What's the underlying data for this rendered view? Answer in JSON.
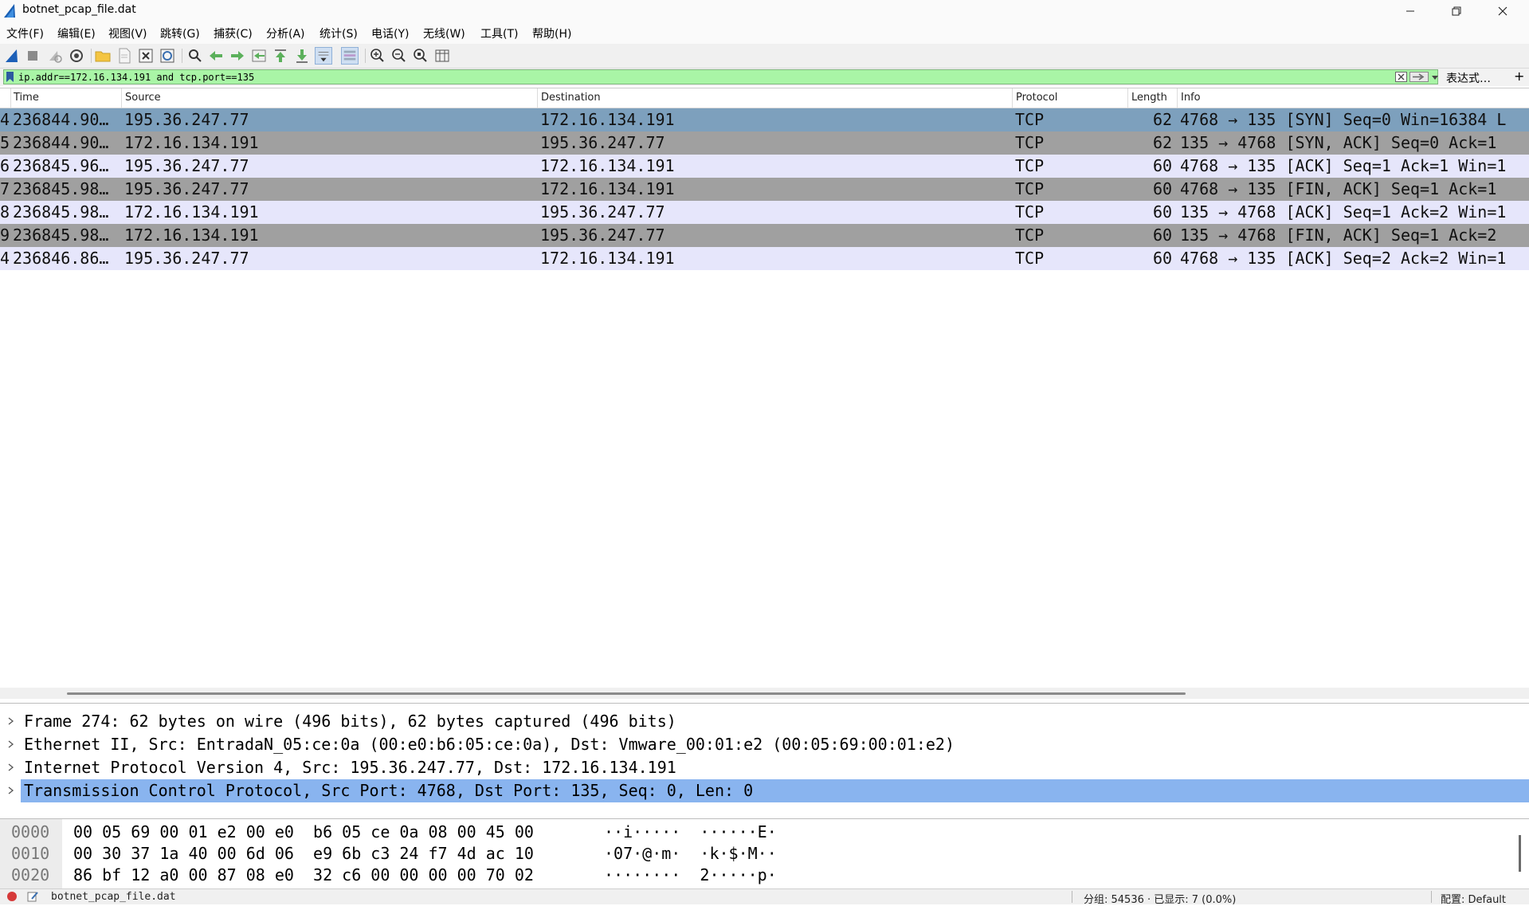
{
  "window": {
    "title": "botnet_pcap_file.dat",
    "app_icon": "wireshark-fin-icon"
  },
  "menu": [
    "文件(F)",
    "编辑(E)",
    "视图(V)",
    "跳转(G)",
    "捕获(C)",
    "分析(A)",
    "统计(S)",
    "电话(Y)",
    "无线(W)",
    "工具(T)",
    "帮助(H)"
  ],
  "toolbar": {
    "icons": [
      "shark-start-icon",
      "stop-icon",
      "restart-icon",
      "capture-options-icon",
      "open-folder-icon",
      "file-icon",
      "close-file-icon",
      "reload-icon",
      "find-icon",
      "go-back-icon",
      "go-forward-icon",
      "go-to-packet-icon",
      "first-packet-icon",
      "last-packet-icon",
      "autoscroll-icon",
      "colorize-icon",
      "zoom-in-icon",
      "zoom-out-icon",
      "zoom-normal-icon",
      "resize-columns-icon"
    ]
  },
  "filter": {
    "value": "ip.addr==172.16.134.191 and tcp.port==135",
    "expression_label": "表达式…",
    "add_label": "+"
  },
  "packet_list": {
    "columns": [
      "Time",
      "Source",
      "Destination",
      "Protocol",
      "Length",
      "Info"
    ],
    "rows": [
      {
        "no": "4",
        "time": "236844.90…",
        "source": "195.36.247.77",
        "destination": "172.16.134.191",
        "protocol": "TCP",
        "length": "62",
        "info": "4768 → 135 [SYN] Seq=0 Win=16384 L",
        "style": "selected"
      },
      {
        "no": "5",
        "time": "236844.90…",
        "source": "172.16.134.191",
        "destination": "195.36.247.77",
        "protocol": "TCP",
        "length": "62",
        "info": "135 → 4768 [SYN, ACK] Seq=0 Ack=1",
        "style": "gray"
      },
      {
        "no": "6",
        "time": "236845.96…",
        "source": "195.36.247.77",
        "destination": "172.16.134.191",
        "protocol": "TCP",
        "length": "60",
        "info": "4768 → 135 [ACK] Seq=1 Ack=1 Win=1",
        "style": "lavender"
      },
      {
        "no": "7",
        "time": "236845.98…",
        "source": "195.36.247.77",
        "destination": "172.16.134.191",
        "protocol": "TCP",
        "length": "60",
        "info": "4768 → 135 [FIN, ACK] Seq=1 Ack=1",
        "style": "gray"
      },
      {
        "no": "8",
        "time": "236845.98…",
        "source": "172.16.134.191",
        "destination": "195.36.247.77",
        "protocol": "TCP",
        "length": "60",
        "info": "135 → 4768 [ACK] Seq=1 Ack=2 Win=1",
        "style": "lavender"
      },
      {
        "no": "9",
        "time": "236845.98…",
        "source": "172.16.134.191",
        "destination": "195.36.247.77",
        "protocol": "TCP",
        "length": "60",
        "info": "135 → 4768 [FIN, ACK] Seq=1 Ack=2",
        "style": "gray"
      },
      {
        "no": "4",
        "time": "236846.86…",
        "source": "195.36.247.77",
        "destination": "172.16.134.191",
        "protocol": "TCP",
        "length": "60",
        "info": "4768 → 135 [ACK] Seq=2 Ack=2 Win=1",
        "style": "lavender"
      }
    ]
  },
  "details": [
    {
      "text": "Frame 274: 62 bytes on wire (496 bits), 62 bytes captured (496 bits)",
      "selected": false
    },
    {
      "text": "Ethernet II, Src: EntradaN_05:ce:0a (00:e0:b6:05:ce:0a), Dst: Vmware_00:01:e2 (00:05:69:00:01:e2)",
      "selected": false
    },
    {
      "text": "Internet Protocol Version 4, Src: 195.36.247.77, Dst: 172.16.134.191",
      "selected": false
    },
    {
      "text": "Transmission Control Protocol, Src Port: 4768, Dst Port: 135, Seq: 0, Len: 0",
      "selected": true
    }
  ],
  "bytes": [
    {
      "offset": "0000",
      "hex": "00 05 69 00 01 e2 00 e0  b6 05 ce 0a 08 00 45 00",
      "ascii": "··i·····  ······E·"
    },
    {
      "offset": "0010",
      "hex": "00 30 37 1a 40 00 6d 06  e9 6b c3 24 f7 4d ac 10",
      "ascii": "·07·@·m·  ·k·$·M··"
    },
    {
      "offset": "0020",
      "hex": "86 bf 12 a0 00 87 08 e0  32 c6 00 00 00 00 70 02",
      "ascii": "········  2·····p·"
    }
  ],
  "status": {
    "file": "botnet_pcap_file.dat",
    "packets": "分组: 54536 · 已显示: 7 (0.0%)",
    "profile": "配置: Default"
  },
  "colors": {
    "filter_valid": "#a9f5a6",
    "row_selected": "#7da0bd",
    "row_gray": "#a0a0a0",
    "row_lavender": "#e6e6fb",
    "detail_selected": "#89b4ef"
  }
}
